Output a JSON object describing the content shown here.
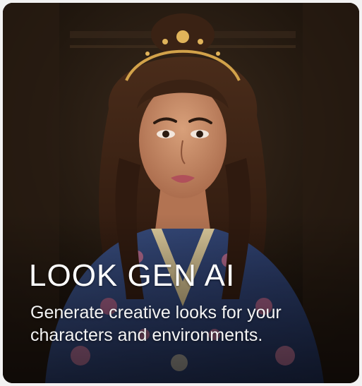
{
  "card": {
    "title": "LOOK GEN AI",
    "description": "Generate creative looks for your characters and environments."
  }
}
